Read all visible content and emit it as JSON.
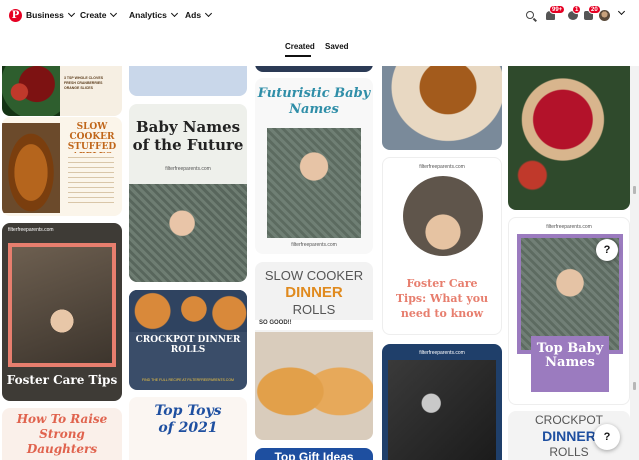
{
  "nav": {
    "business": "Business",
    "create": "Create",
    "analytics": "Analytics",
    "ads": "Ads",
    "notif_badge": "99+",
    "messages_badge": "1",
    "updates_badge": "20"
  },
  "tabs": {
    "created": "Created",
    "saved": "Saved"
  },
  "pins": {
    "apples": {
      "title": "SLOW COOKER STUFFED APPLES"
    },
    "cider": {
      "lines": [
        "3 TSP WHOLE CLOVES",
        "FRESH CRANBERRIES",
        "ORANGE SLICES"
      ]
    },
    "baby_future": {
      "title": "Baby Names of the Future",
      "url": "filterfreeparents.com"
    },
    "futuristic": {
      "title": "Futuristic Baby Names",
      "url": "filterfreeparents.com"
    },
    "foster_left": {
      "url": "filterfreeparents.com",
      "title": "Foster Care Tips"
    },
    "foster_mid": {
      "url": "filterfreeparents.com",
      "title": "Foster Care Tips: What you need to know"
    },
    "top_baby": {
      "url": "filterfreeparents.com",
      "title": "Top Baby Names"
    },
    "rolls_small": {
      "title": "CROCKPOT DINNER ROLLS",
      "caption": "FIND THE FULL RECIPE AT FILTERFREEPARENTS.COM"
    },
    "slow_rolls": {
      "line1": "SLOW COOKER",
      "line2": "DINNER",
      "line3": "ROLLS",
      "tag": "SO GOOD!!"
    },
    "keys": {
      "url": "filterfreeparents.com"
    },
    "crockpot_right": {
      "line1": "CROCKPOT",
      "line2": "DINNER",
      "line3": "ROLLS"
    },
    "raise": {
      "title": "How To Raise Strong Daughters"
    },
    "toys": {
      "title": "Top Toys of 2021"
    },
    "gift": {
      "title": "Top Gift Ideas"
    }
  },
  "help": "?"
}
